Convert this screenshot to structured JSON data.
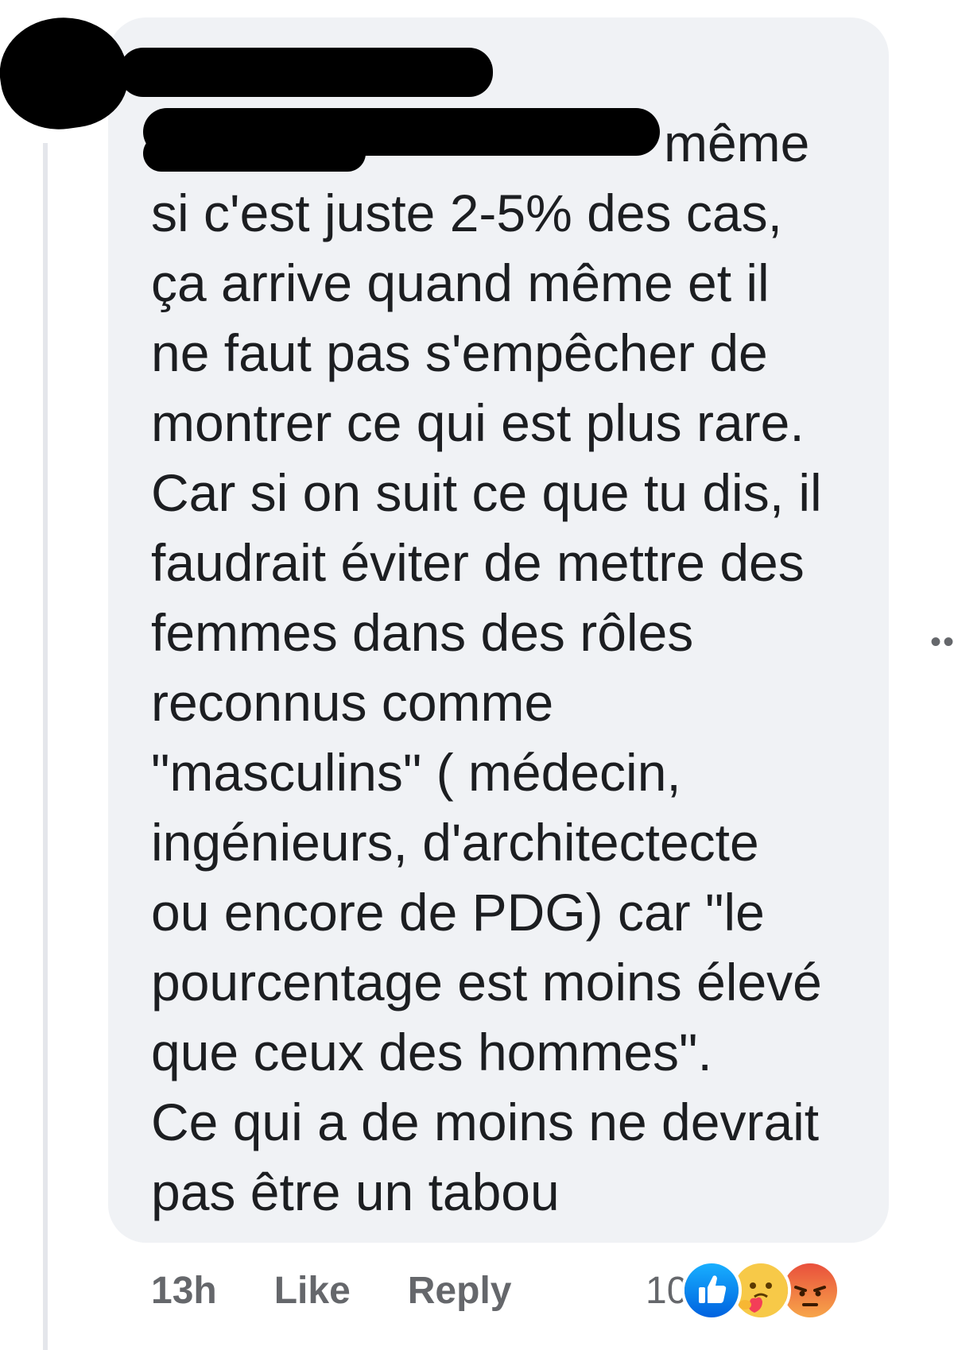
{
  "comment": {
    "first_line_visible": "même",
    "body": "si c'est juste 2-5% des cas,\nça arrive quand même et il\nne faut pas s'empêcher de\nmontrer ce qui est plus rare.\nCar si on suit ce que tu dis, il\nfaudrait éviter de mettre des\nfemmes dans des rôles\nreconnus comme\n\"masculins\" ( médecin,\ningénieurs, d'architectecte\nou encore de PDG) car \"le\npourcentage est moins élevé\nque ceux des hommes\".\nCe qui a de moins ne devrait\npas être un tabou"
  },
  "actions": {
    "time": "13h",
    "like": "Like",
    "reply": "Reply"
  },
  "reactions": {
    "count": "10",
    "icons": [
      "like-icon",
      "care-icon",
      "angry-icon"
    ]
  },
  "colors": {
    "bubble": "#f0f2f5",
    "text": "#1c1e21",
    "muted": "#65676b",
    "like_blue": "#1877f2"
  }
}
